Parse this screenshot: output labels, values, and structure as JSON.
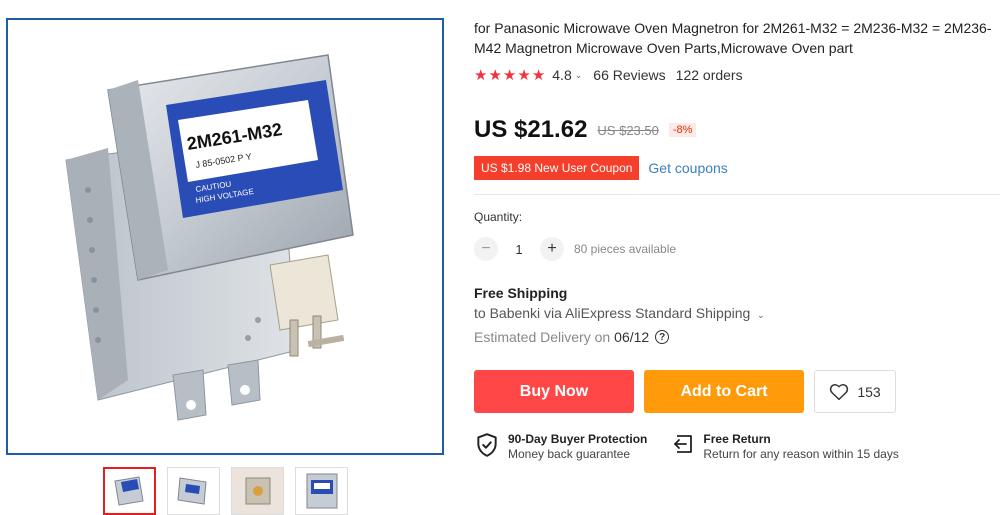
{
  "product": {
    "title": "for Panasonic Microwave Oven Magnetron for 2M261-M32 = 2M236-M32 = 2M236-M42 Magnetron Microwave Oven Parts,Microwave Oven part",
    "rating": "4.8",
    "reviews": "66 Reviews",
    "orders": "122 orders",
    "stars": 5
  },
  "image": {
    "label_model": "2M261-M32",
    "label_code": "J  85-0502  P  Y",
    "label_caution": "CAUTIOU",
    "label_voltage": "HIGH VOLTAGE"
  },
  "price": {
    "current": "US $21.62",
    "original": "US $23.50",
    "discount": "-8%"
  },
  "coupon": {
    "badge": "US $1.98 New User Coupon",
    "link": "Get coupons"
  },
  "quantity": {
    "label": "Quantity:",
    "value": "1",
    "minus": "−",
    "plus": "+",
    "available": "80 pieces available"
  },
  "shipping": {
    "title": "Free Shipping",
    "subtitle": "to Babenki via AliExpress Standard Shipping",
    "delivery_label": "Estimated Delivery on",
    "delivery_date": "06/12"
  },
  "actions": {
    "buy_now": "Buy Now",
    "add_to_cart": "Add to Cart",
    "wish_count": "153"
  },
  "guarantees": [
    {
      "title": "90-Day Buyer Protection",
      "subtitle": "Money back guarantee",
      "icon": "shield-check-icon"
    },
    {
      "title": "Free Return",
      "subtitle": "Return for any reason within 15 days",
      "icon": "return-icon"
    }
  ],
  "colors": {
    "star": "#f0343f",
    "buy_now": "#ff4747",
    "add_to_cart": "#ff9a0b",
    "coupon": "#f63f2b",
    "link": "#3b7fbf",
    "image_border": "#1e5ba8"
  }
}
